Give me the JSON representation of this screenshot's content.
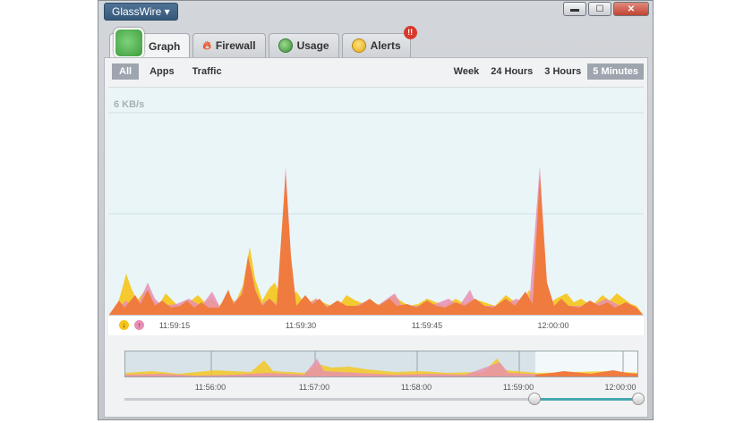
{
  "app": {
    "menu_label": "GlassWire ▾"
  },
  "window_controls": {
    "minimize": "▬",
    "maximize": "☐",
    "close": "✕"
  },
  "tabs": [
    {
      "label": "Graph",
      "icon": "graph-logo-icon"
    },
    {
      "label": "Firewall",
      "icon": "flame-icon"
    },
    {
      "label": "Usage",
      "icon": "pie-icon"
    },
    {
      "label": "Alerts",
      "icon": "bulb-icon",
      "badge": "!!"
    }
  ],
  "filters": [
    "All",
    "Apps",
    "Traffic"
  ],
  "active_filter": "All",
  "ranges": [
    "Week",
    "24 Hours",
    "3 Hours",
    "5 Minutes"
  ],
  "active_range": "5 Minutes",
  "graph": {
    "y_label": "6 KB/s",
    "time_ticks": [
      "11:59:15",
      "11:59:30",
      "11:59:45",
      "12:00:00"
    ],
    "download_icon": "↓",
    "upload_icon": "↑",
    "colors": {
      "download": "#f5c518",
      "upload": "#f07b3f",
      "overlap": "#e78fb3",
      "background": "#eaf5f8"
    }
  },
  "overview": {
    "time_ticks": [
      "11:56:00",
      "11:57:00",
      "11:58:00",
      "11:59:00",
      "12:00:00"
    ]
  }
}
